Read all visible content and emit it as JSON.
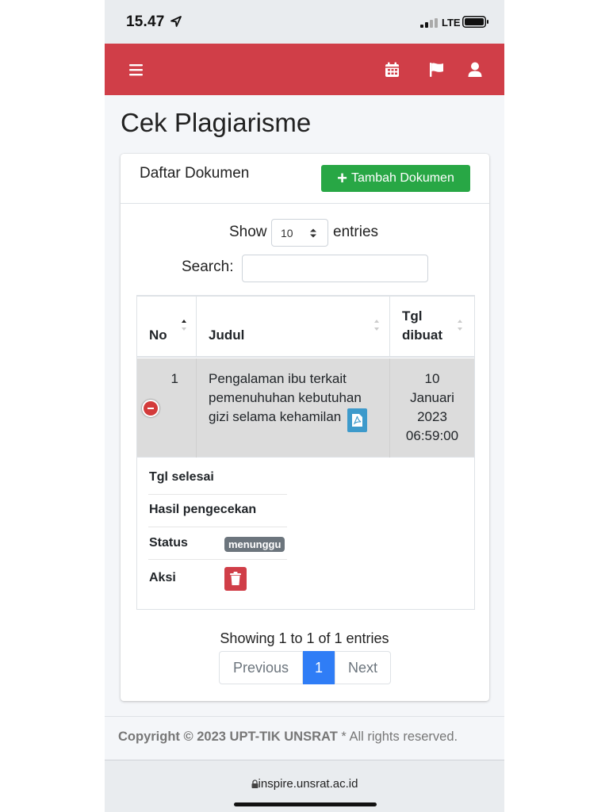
{
  "status_bar": {
    "time": "15.47",
    "network": "LTE"
  },
  "navbar": {
    "menu_icon": "hamburger-icon",
    "icons": [
      "calendar-icon",
      "flag-icon",
      "user-icon"
    ],
    "color": "#d03e48"
  },
  "page": {
    "title": "Cek Plagiarisme"
  },
  "card": {
    "title": "Daftar Dokumen",
    "add_button": "Tambah Dokumen"
  },
  "table_controls": {
    "show_label": "Show",
    "entries_value": "10",
    "entries_label": "entries",
    "search_label": "Search:",
    "search_value": ""
  },
  "table": {
    "headers": {
      "no": "No",
      "judul": "Judul",
      "tgl_line1": "Tgl",
      "tgl_line2": "dibuat"
    },
    "row": {
      "no": "1",
      "judul_lines": [
        "Pengalaman ibu terkait",
        "pemenuhuhan kebutuhan",
        "gizi selama kehamilan"
      ],
      "tgl_lines": [
        "10",
        "Januari",
        "2023",
        "06:59:00"
      ]
    },
    "details": {
      "tgl_selesai": "Tgl selesai",
      "hasil": "Hasil pengecekan",
      "status_label": "Status",
      "status_value": "menunggu",
      "aksi": "Aksi"
    }
  },
  "pagination": {
    "info": "Showing 1 to 1 of 1 entries",
    "previous": "Previous",
    "current": "1",
    "next": "Next"
  },
  "footer": {
    "copyright": "Copyright © 2023 UPT-TIK UNSRAT",
    "rights": " * All rights reserved."
  },
  "browser": {
    "url": "inspire.unsrat.ac.id"
  },
  "colors": {
    "accent": "#d03e48",
    "success": "#28a745",
    "primary": "#2f7df6",
    "secondary": "#6c757d"
  }
}
